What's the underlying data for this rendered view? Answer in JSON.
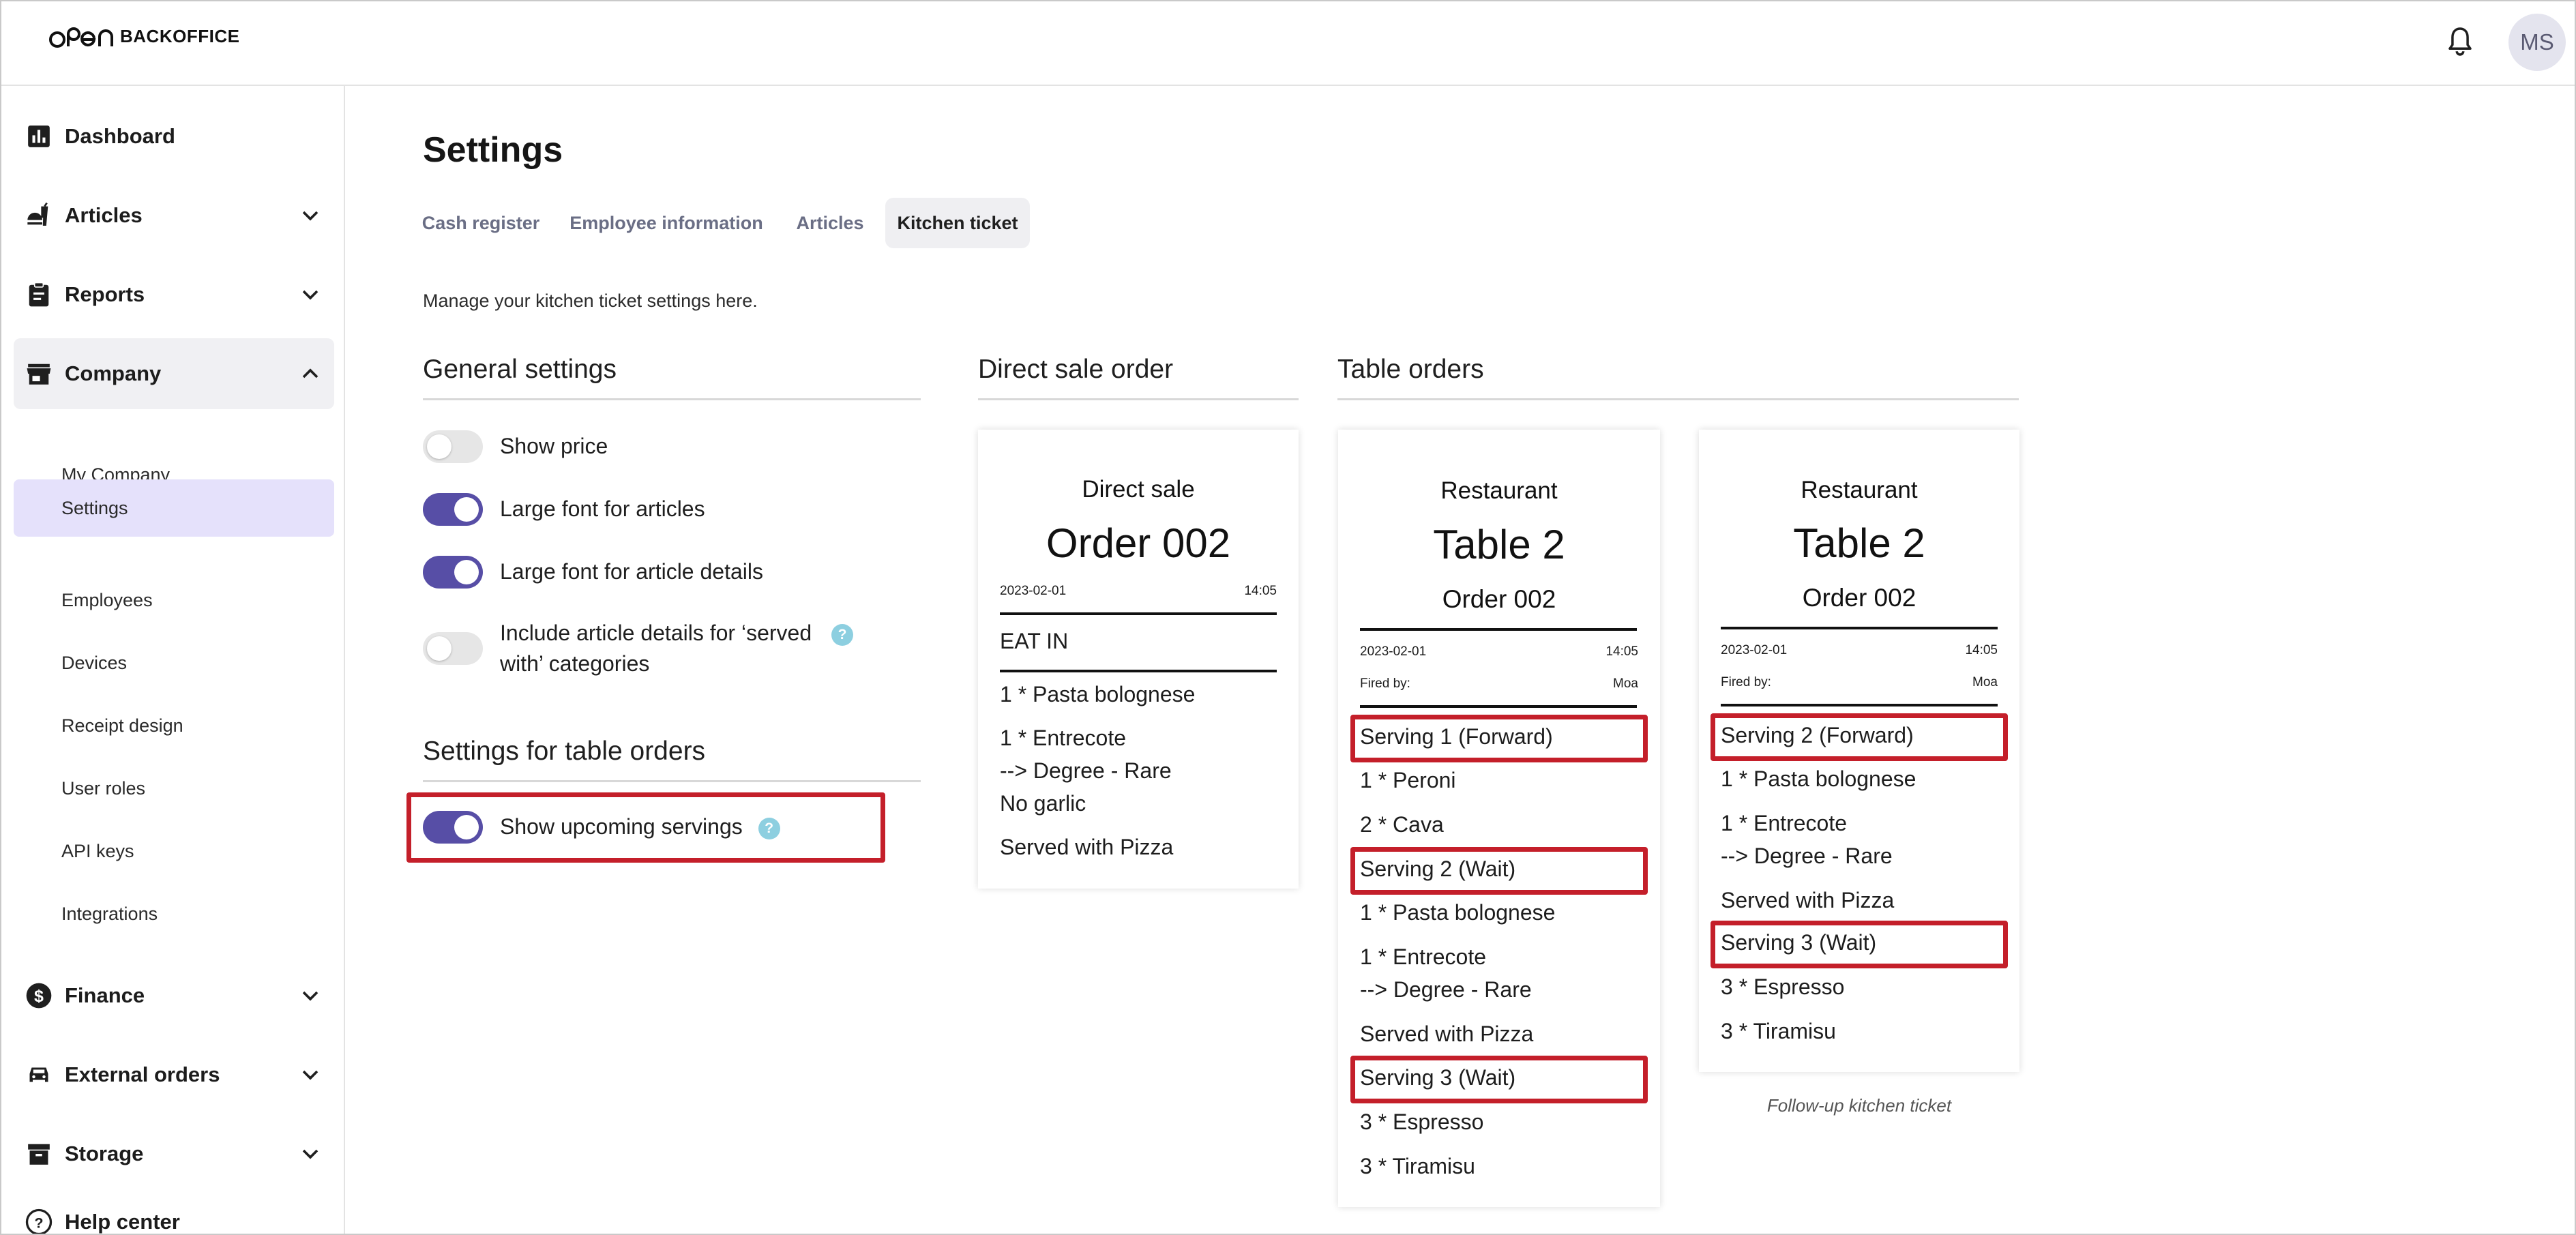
{
  "header": {
    "logo_text": "BACKOFFICE",
    "user_initials": "MS"
  },
  "sidebar": {
    "items": [
      {
        "label": "Dashboard",
        "icon": "bar-chart-icon"
      },
      {
        "label": "Articles",
        "icon": "food-icon"
      },
      {
        "label": "Reports",
        "icon": "clipboard-icon"
      },
      {
        "label": "Company",
        "icon": "store-icon"
      },
      {
        "label": "Finance",
        "icon": "dollar-icon"
      },
      {
        "label": "External orders",
        "icon": "car-icon"
      },
      {
        "label": "Storage",
        "icon": "archive-icon"
      },
      {
        "label": "Help center",
        "icon": "help-icon"
      }
    ],
    "company_sub": [
      "My Company",
      "Settings",
      "Employees",
      "Devices",
      "Receipt design",
      "User roles",
      "API keys",
      "Integrations"
    ]
  },
  "page": {
    "title": "Settings",
    "tabs": [
      "Cash register",
      "Employee information",
      "Articles",
      "Kitchen ticket"
    ],
    "active_tab": "Kitchen ticket",
    "description": "Manage your kitchen ticket settings here."
  },
  "general": {
    "heading": "General settings",
    "toggles": [
      {
        "label": "Show price",
        "on": false
      },
      {
        "label": "Large font for articles",
        "on": true
      },
      {
        "label": "Large font for article details",
        "on": true
      },
      {
        "label_line1": "Include article details for ‘served",
        "label_line2": "with’ categories",
        "on": false
      }
    ]
  },
  "table_settings": {
    "heading": "Settings for table orders",
    "toggle_label": "Show upcoming servings",
    "on": true
  },
  "direct_sale": {
    "heading": "Direct sale order",
    "ticket": {
      "type": "Direct sale",
      "order": "Order 002",
      "date": "2023-02-01",
      "time": "14:05",
      "mode": "EAT IN",
      "lines": [
        "1 * Pasta bolognese",
        "1 * Entrecote",
        "--> Degree - Rare",
        "No garlic",
        "Served with Pizza"
      ]
    }
  },
  "table_orders": {
    "heading": "Table orders",
    "ticket1": {
      "venue": "Restaurant",
      "table": "Table 2",
      "order": "Order 002",
      "date": "2023-02-01",
      "time": "14:05",
      "fired_label": "Fired by:",
      "fired_by": "Moa",
      "serving1": "Serving 1 (Forward)",
      "s1_lines": [
        "1 * Peroni",
        "2 * Cava"
      ],
      "serving2": "Serving 2 (Wait)",
      "s2_lines": [
        "1 * Pasta bolognese",
        "1 * Entrecote",
        "--> Degree - Rare",
        "Served with Pizza"
      ],
      "serving3": "Serving 3 (Wait)",
      "s3_lines": [
        "3 * Espresso",
        "3 * Tiramisu"
      ]
    },
    "ticket2": {
      "venue": "Restaurant",
      "table": "Table 2",
      "order": "Order 002",
      "date": "2023-02-01",
      "time": "14:05",
      "fired_label": "Fired by:",
      "fired_by": "Moa",
      "serving2": "Serving 2 (Forward)",
      "s2_lines": [
        "1 * Pasta bolognese",
        "1 * Entrecote",
        "--> Degree - Rare",
        "Served with Pizza"
      ],
      "serving3": "Serving 3 (Wait)",
      "s3_lines": [
        "3 * Espresso",
        "3 * Tiramisu"
      ],
      "caption": "Follow-up kitchen ticket"
    }
  },
  "colors": {
    "accent": "#574ea6",
    "highlight": "#c41f2a",
    "selected_nav": "#e5e1fb",
    "help": "#8dcfe0"
  }
}
